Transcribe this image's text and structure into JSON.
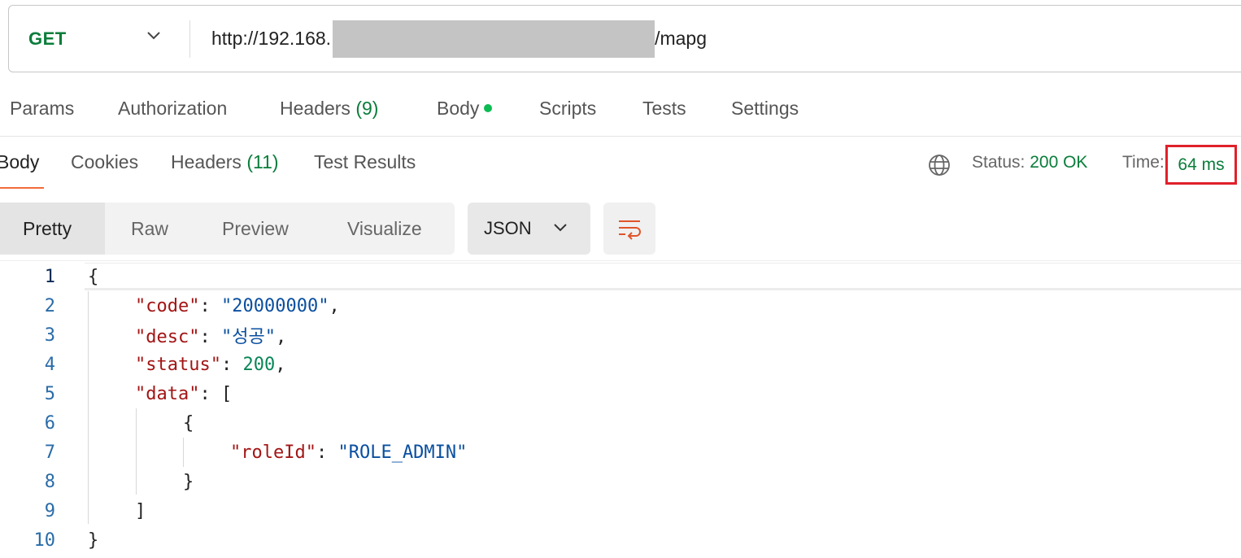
{
  "request": {
    "method": "GET",
    "url_prefix": "http://192.168.",
    "url_suffix": "/mapg"
  },
  "request_tabs": [
    {
      "label": "Params"
    },
    {
      "label": "Authorization"
    },
    {
      "label": "Headers",
      "count": "(9)"
    },
    {
      "label": "Body"
    },
    {
      "label": "Scripts"
    },
    {
      "label": "Tests"
    },
    {
      "label": "Settings"
    }
  ],
  "response_tabs": [
    {
      "label": "Body"
    },
    {
      "label": "Cookies"
    },
    {
      "label": "Headers",
      "count": "(11)"
    },
    {
      "label": "Test Results"
    }
  ],
  "response_meta": {
    "status_label": "Status:",
    "status_value": "200 OK",
    "time_label": "Time:",
    "time_value": "64 ms"
  },
  "view_modes": [
    "Pretty",
    "Raw",
    "Preview",
    "Visualize"
  ],
  "format": "JSON",
  "code_lines": [
    {
      "n": "1"
    },
    {
      "n": "2"
    },
    {
      "n": "3"
    },
    {
      "n": "4"
    },
    {
      "n": "5"
    },
    {
      "n": "6"
    },
    {
      "n": "7"
    },
    {
      "n": "8"
    },
    {
      "n": "9"
    },
    {
      "n": "10"
    }
  ],
  "json": {
    "open": "{",
    "close": "}",
    "code_key": "\"code\"",
    "code_val": "\"20000000\"",
    "desc_key": "\"desc\"",
    "desc_val": "\"성공\"",
    "status_key": "\"status\"",
    "status_val": "200",
    "data_key": "\"data\"",
    "arr_open": "[",
    "arr_close": "]",
    "roleId_key": "\"roleId\"",
    "roleId_val": "\"ROLE_ADMIN\""
  },
  "colors": {
    "accent": "#f26b3a",
    "success": "#0a7d3b",
    "highlight_box": "#e0202a"
  }
}
